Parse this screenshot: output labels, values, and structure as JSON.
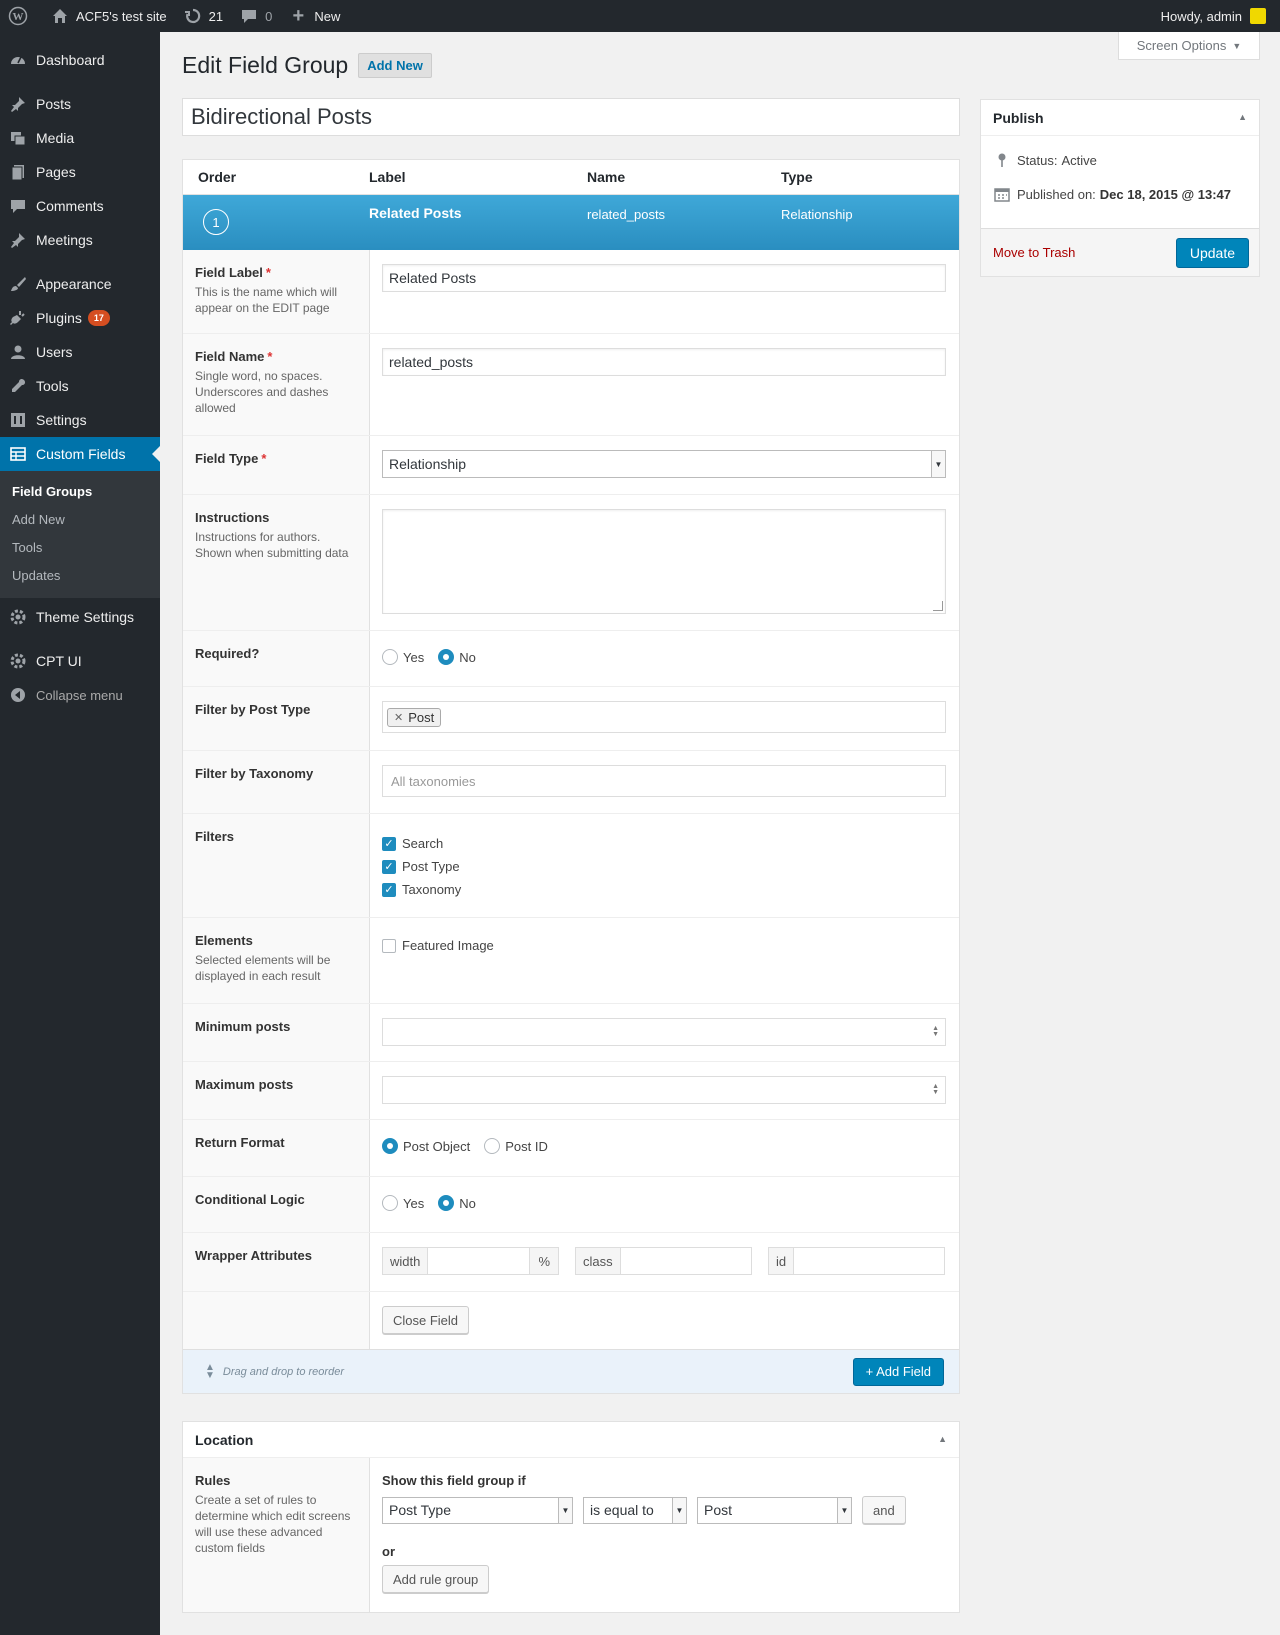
{
  "admin_bar": {
    "site_name": "ACF5's test site",
    "updates_count": "21",
    "comments_count": "0",
    "new_label": "New",
    "howdy": "Howdy, admin"
  },
  "sidebar": {
    "items": [
      {
        "label": "Dashboard",
        "icon": "dashboard-icon"
      },
      {
        "label": "Posts",
        "icon": "pin-icon"
      },
      {
        "label": "Media",
        "icon": "media-icon"
      },
      {
        "label": "Pages",
        "icon": "pages-icon"
      },
      {
        "label": "Comments",
        "icon": "comment-icon"
      },
      {
        "label": "Meetings",
        "icon": "pin-icon"
      },
      {
        "label": "Appearance",
        "icon": "brush-icon"
      },
      {
        "label": "Plugins",
        "icon": "plug-icon",
        "badge": "17"
      },
      {
        "label": "Users",
        "icon": "user-icon"
      },
      {
        "label": "Tools",
        "icon": "wrench-icon"
      },
      {
        "label": "Settings",
        "icon": "settings-icon"
      },
      {
        "label": "Custom Fields",
        "icon": "table-icon"
      },
      {
        "label": "Theme Settings",
        "icon": "gear-icon"
      },
      {
        "label": "CPT UI",
        "icon": "gear-icon"
      }
    ],
    "submenu": [
      "Field Groups",
      "Add New",
      "Tools",
      "Updates"
    ],
    "collapse": "Collapse menu"
  },
  "screen_options": "Screen Options",
  "page": {
    "title": "Edit Field Group",
    "add_new": "Add New",
    "group_title": "Bidirectional Posts"
  },
  "fields_table": {
    "headers": [
      "Order",
      "Label",
      "Name",
      "Type"
    ],
    "active_field": {
      "order": "1",
      "label": "Related Posts",
      "name": "related_posts",
      "type": "Relationship"
    }
  },
  "settings": {
    "field_label": {
      "label": "Field Label",
      "desc": "This is the name which will appear on the EDIT page",
      "value": "Related Posts"
    },
    "field_name": {
      "label": "Field Name",
      "desc": "Single word, no spaces. Underscores and dashes allowed",
      "value": "related_posts"
    },
    "field_type": {
      "label": "Field Type",
      "value": "Relationship"
    },
    "instructions": {
      "label": "Instructions",
      "desc": "Instructions for authors. Shown when submitting data"
    },
    "required": {
      "label": "Required?",
      "yes": "Yes",
      "no": "No",
      "selected": "No"
    },
    "filter_post_type": {
      "label": "Filter by Post Type",
      "token": "Post"
    },
    "filter_taxonomy": {
      "label": "Filter by Taxonomy",
      "placeholder": "All taxonomies"
    },
    "filters": {
      "label": "Filters",
      "options": [
        "Search",
        "Post Type",
        "Taxonomy"
      ]
    },
    "elements": {
      "label": "Elements",
      "desc": "Selected elements will be displayed in each result",
      "option": "Featured Image"
    },
    "min_posts": {
      "label": "Minimum posts"
    },
    "max_posts": {
      "label": "Maximum posts"
    },
    "return_format": {
      "label": "Return Format",
      "opt1": "Post Object",
      "opt2": "Post ID",
      "selected": "Post Object"
    },
    "conditional_logic": {
      "label": "Conditional Logic",
      "yes": "Yes",
      "no": "No",
      "selected": "No"
    },
    "wrapper": {
      "label": "Wrapper Attributes",
      "width": "width",
      "percent": "%",
      "class": "class",
      "id": "id"
    },
    "close_field": "Close Field"
  },
  "footer": {
    "drag_text": "Drag and drop to reorder",
    "add_field": "+ Add Field"
  },
  "location": {
    "title": "Location",
    "rules_label": "Rules",
    "rules_desc": "Create a set of rules to determine which edit screens will use these advanced custom fields",
    "show_if": "Show this field group if",
    "param": "Post Type",
    "operator": "is equal to",
    "value": "Post",
    "and": "and",
    "or": "or",
    "add_rule_group": "Add rule group"
  },
  "publish": {
    "title": "Publish",
    "status_label": "Status:",
    "status_value": "Active",
    "published_label": "Published on:",
    "published_value": "Dec 18, 2015 @ 13:47",
    "trash": "Move to Trash",
    "update": "Update"
  }
}
